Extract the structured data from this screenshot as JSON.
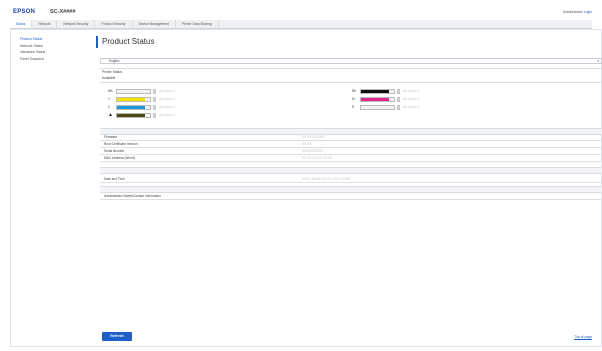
{
  "header": {
    "brand": "EPSON",
    "model": "SC-X####",
    "admin_label": "Administrator",
    "admin_link": "Login"
  },
  "tabs": [
    "Status",
    "Network",
    "Network Security",
    "Product Security",
    "Device Management",
    "Printer Data Sharing"
  ],
  "sidebar": {
    "items": [
      {
        "label": "Product Status"
      },
      {
        "label": "Network Status"
      },
      {
        "label": "Hardware Status"
      },
      {
        "label": "Panel Snapshot"
      }
    ]
  },
  "page": {
    "title": "Product Status",
    "language": "English",
    "printer_status_label": "Printer Status",
    "printer_status_value": "Available"
  },
  "inks_left": [
    {
      "code": "MK",
      "color": "#ffffff",
      "level": 0
    },
    {
      "code": "Y",
      "color": "#f5e400",
      "level": 0.85
    },
    {
      "code": "C",
      "color": "#1e9bd7",
      "level": 0.85
    },
    {
      "code": "",
      "color": "#4b4a14",
      "level": 0.85,
      "warning": true
    }
  ],
  "inks_right": [
    {
      "code": "BK",
      "color": "#111111",
      "level": 0.85
    },
    {
      "code": "M",
      "color": "#e0288c",
      "level": 0.85
    },
    {
      "code": "R",
      "color": "#ffffff",
      "level": 0
    }
  ],
  "ink_ref_label": "SC-XXXX-X",
  "info_rows": [
    {
      "key": "Firmware",
      "value": "XX.XX.XX.XXX"
    },
    {
      "key": "Root Certificate Version",
      "value": "XX.XX"
    },
    {
      "key": "Serial Number",
      "value": "XXXXXXXXXX"
    },
    {
      "key": "MAC Address (Wired)",
      "value": "XX:XX:XX:XX:XX:XX"
    }
  ],
  "date_row": {
    "key": "Date and Time",
    "value": "XXXX-XX-XX XX:XX UTC+XX:XX"
  },
  "admin_row": {
    "key": "Administrator Name/Contact Information",
    "value": ""
  },
  "footer": {
    "refresh": "Refresh",
    "top_link": "Top of page"
  }
}
